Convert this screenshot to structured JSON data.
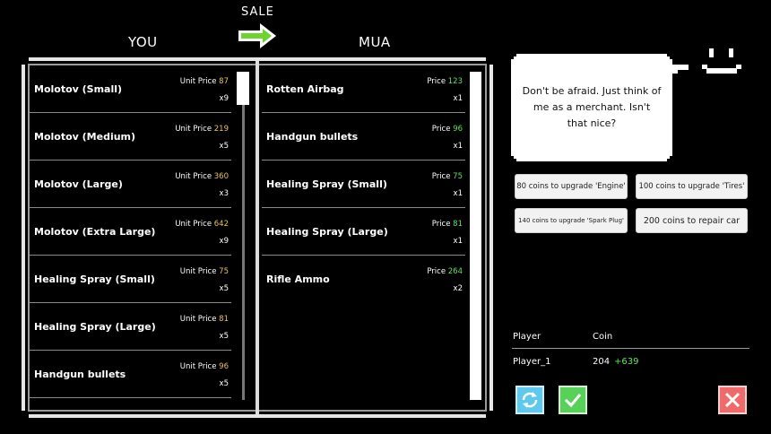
{
  "header": {
    "you_label": "YOU",
    "mua_label": "MUA",
    "sale_label": "SALE"
  },
  "left_list": {
    "price_label": "Unit Price",
    "items": [
      {
        "name": "Molotov (Small)",
        "price": "87",
        "qty": "x9"
      },
      {
        "name": "Molotov (Medium)",
        "price": "219",
        "qty": "x5"
      },
      {
        "name": "Molotov (Large)",
        "price": "360",
        "qty": "x3"
      },
      {
        "name": "Molotov (Extra Large)",
        "price": "642",
        "qty": "x9"
      },
      {
        "name": "Healing Spray (Small)",
        "price": "75",
        "qty": "x5"
      },
      {
        "name": "Healing Spray (Large)",
        "price": "81",
        "qty": "x5"
      },
      {
        "name": "Handgun bullets",
        "price": "96",
        "qty": "x5"
      }
    ]
  },
  "right_list": {
    "price_label": "Price",
    "items": [
      {
        "name": "Rotten Airbag",
        "price": "123",
        "qty": "x1"
      },
      {
        "name": "Handgun bullets",
        "price": "96",
        "qty": "x1"
      },
      {
        "name": "Healing Spray (Small)",
        "price": "75",
        "qty": "x1"
      },
      {
        "name": "Healing Spray (Large)",
        "price": "81",
        "qty": "x1"
      },
      {
        "name": "Rifle Ammo",
        "price": "264",
        "qty": "x2"
      }
    ]
  },
  "merchant": {
    "speech": "Don't be afraid. Just think of me as a merchant. Isn't that nice?"
  },
  "upgrades": {
    "engine": "80 coins to upgrade 'Engine'",
    "tires": "100 coins to upgrade 'Tires'",
    "spark_plug": "140 coins to upgrade 'Spark Plug'",
    "repair": "200 coins to repair car"
  },
  "player_table": {
    "player_header": "Player",
    "coin_header": "Coin",
    "player_name": "Player_1",
    "coins": "204",
    "coin_delta": "+639"
  },
  "colors": {
    "price_yellow": "#e8c35a",
    "price_green": "#5ee35e",
    "refresh_button": "#5fc8ef",
    "confirm_button": "#57d157",
    "cancel_button": "#f06a6a"
  },
  "icons": {
    "sale_arrow": "right-arrow-icon",
    "refresh": "refresh-icon",
    "confirm": "checkmark-icon",
    "cancel": "close-icon"
  }
}
